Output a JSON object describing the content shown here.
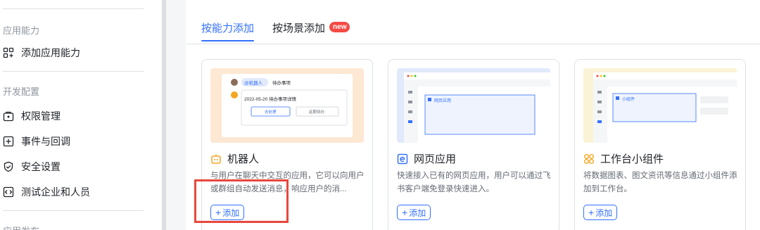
{
  "sidebar": {
    "section_ability": "应用能力",
    "add_ability": "添加应用能力",
    "section_dev": "开发配置",
    "items": [
      {
        "label": "权限管理"
      },
      {
        "label": "事件与回调"
      },
      {
        "label": "安全设置"
      },
      {
        "label": "测试企业和人员"
      }
    ],
    "section_publish": "应用发布"
  },
  "tabs": [
    {
      "label": "按能力添加",
      "active": true
    },
    {
      "label": "按场景添加",
      "badge": "new"
    }
  ],
  "cards": [
    {
      "title": "机器人",
      "description": "与用户在聊天中交互的应用，它可以向用户或群组自动发送消息，响应用户的消...",
      "add_label": "添加",
      "preview": {
        "bot_tag": "@机器人",
        "bot_msg": "待办事项",
        "date_line": "2022-05-20 待办事项详情",
        "btn1": "去处理",
        "btn2": "延期待办",
        "bg": "#fde8d3"
      }
    },
    {
      "title": "网页应用",
      "description": "快速接入已有的网页应用，用户可以通过飞书客户端免登录快速进入。",
      "add_label": "添加",
      "preview": {
        "inner_label": "网页应用",
        "bg": "#e1e9fb"
      }
    },
    {
      "title": "工作台小组件",
      "description": "将数据图表、图文资讯等信息通过小组件添加到工作台。",
      "add_label": "添加",
      "preview": {
        "inner_label": "小组件",
        "bg": "#fbf3d6"
      }
    }
  ],
  "colors": {
    "accent": "#3370ff",
    "highlight": "#e8483e"
  }
}
